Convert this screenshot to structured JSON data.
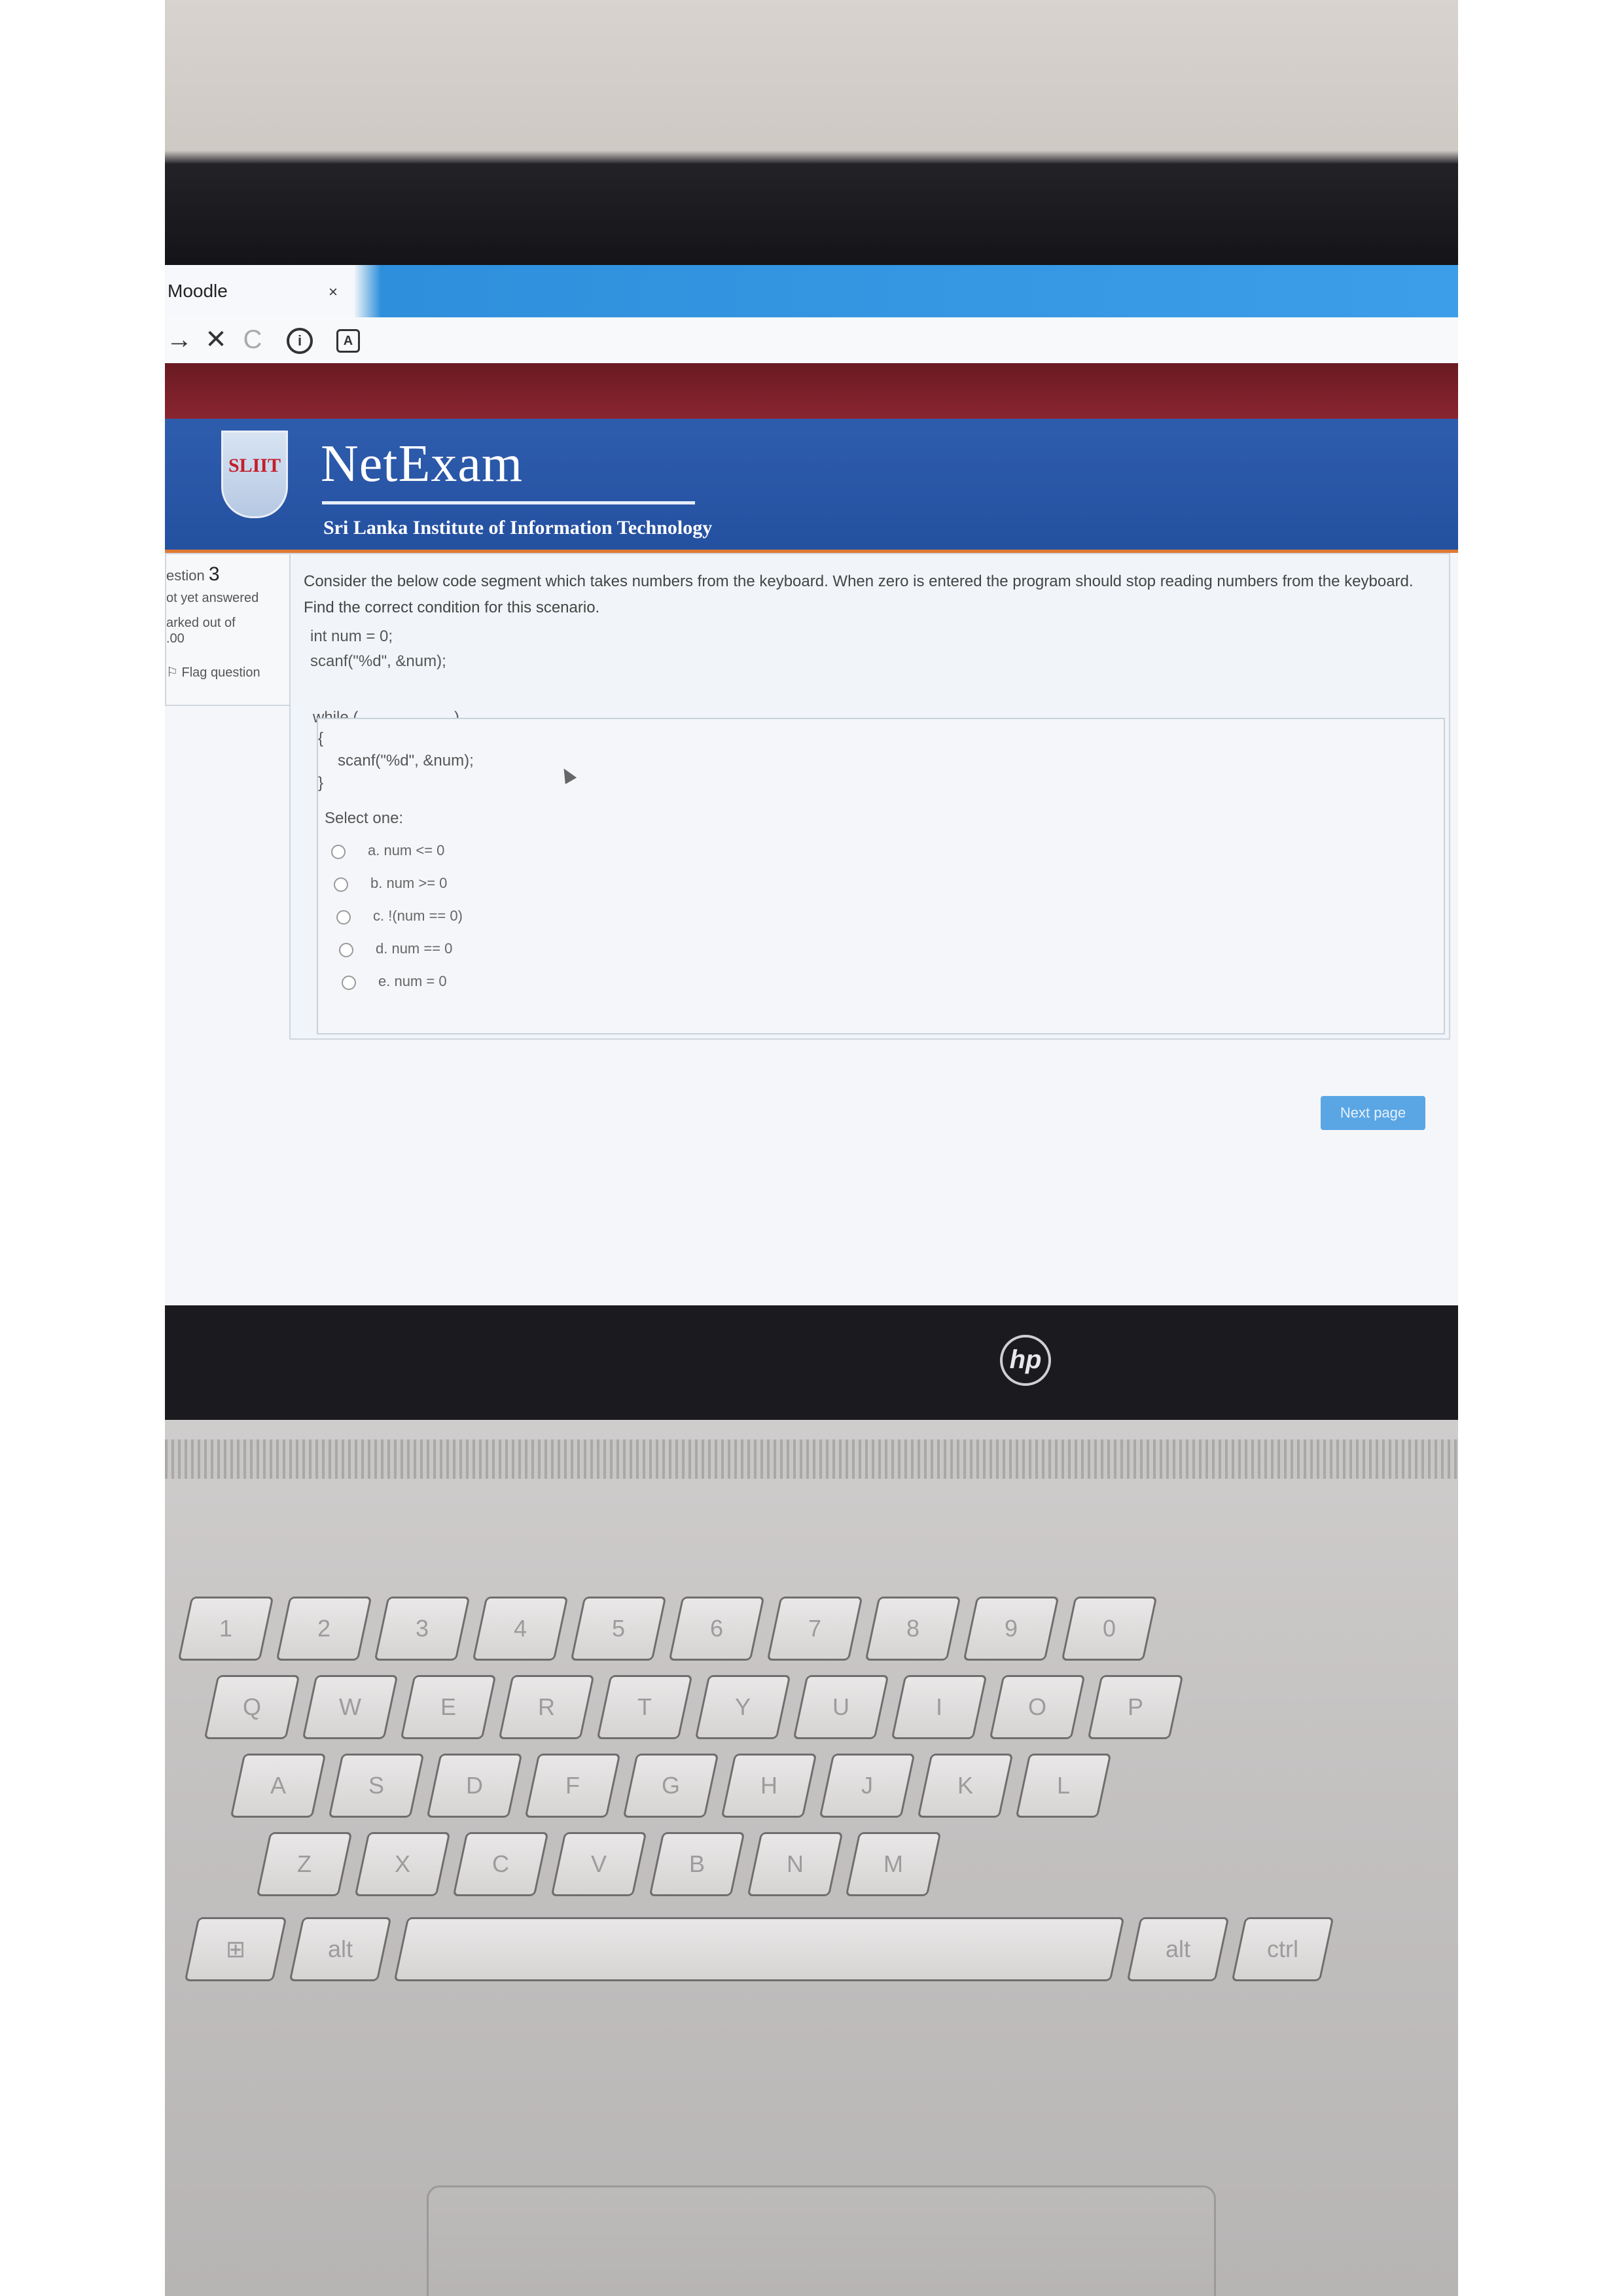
{
  "browser": {
    "tab_title": "Moodle",
    "tab_close": "×",
    "nav_forward": "→",
    "nav_stop": "✕",
    "nav_reload": "C",
    "info_icon": "i",
    "doc_icon": "A"
  },
  "header": {
    "brand": "NetExam",
    "subtitle": "Sri Lanka Institute of Information Technology",
    "logo_text": "SLIIT"
  },
  "question_info": {
    "label": "estion",
    "number": "3",
    "status": "ot yet answered",
    "marks_line1": "arked out of",
    "marks_line2": ".00",
    "flag": "Flag question"
  },
  "question": {
    "text": "Consider the below code segment which takes numbers from the keyboard. When zero is entered the program should stop reading numbers from the keyboard. Find the correct condition for this scenario.",
    "code": [
      "int num = 0;",
      "scanf(\"%d\", &num);",
      "while (......................)",
      "{",
      "scanf(\"%d\", &num);",
      "}"
    ],
    "select_one": "Select one:",
    "options": [
      "a. num <= 0",
      "b. num >= 0",
      "c. !(num == 0)",
      "d. num == 0",
      "e. num = 0"
    ]
  },
  "next_button": "Next page",
  "laptop_logo": "hp",
  "keyboard": {
    "row1": [
      "1",
      "2",
      "3",
      "4",
      "5",
      "6",
      "7",
      "8",
      "9",
      "0"
    ],
    "row2": [
      "Q",
      "W",
      "E",
      "R",
      "T",
      "Y",
      "U",
      "I",
      "O",
      "P"
    ],
    "row3": [
      "A",
      "S",
      "D",
      "F",
      "G",
      "H",
      "J",
      "K",
      "L"
    ],
    "row4": [
      "Z",
      "X",
      "C",
      "V",
      "B",
      "N",
      "M"
    ],
    "row5": [
      "alt",
      "alt",
      "ctrl"
    ]
  },
  "colors": {
    "header_blue": "#2450a0",
    "header_accent": "#e07a33",
    "browser_blue": "#3c9ee8",
    "next_button": "#5aa6e5"
  }
}
